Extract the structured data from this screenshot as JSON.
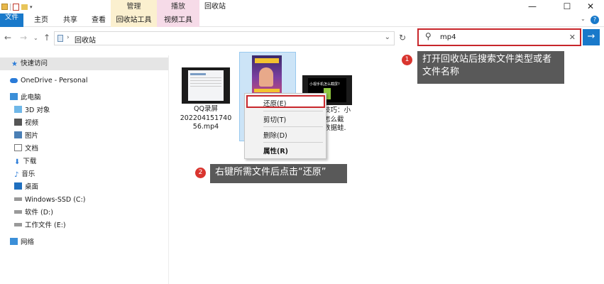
{
  "window": {
    "title": "回收站",
    "context_tabs": {
      "manage": "管理",
      "play": "播放"
    }
  },
  "ribbon": {
    "tabs": [
      "文件",
      "主页",
      "共享",
      "查看",
      "回收站工具",
      "视频工具"
    ]
  },
  "address": {
    "location": "回收站"
  },
  "search": {
    "query": "mp4"
  },
  "nav": {
    "items": [
      "快速访问",
      "OneDrive - Personal",
      "此电脑",
      "3D 对象",
      "视频",
      "图片",
      "文档",
      "下载",
      "音乐",
      "桌面",
      "Windows-SSD (C:)",
      "软件 (D:)",
      "工作文件 (E:)",
      "网络"
    ]
  },
  "files": [
    {
      "name_lines": [
        "QQ录屏",
        "202204151740",
        "56.mp4"
      ]
    },
    {
      "name_lines": [
        ""
      ]
    },
    {
      "name_lines": [
        "技巧：小",
        "怎么截",
        "数据蛙."
      ]
    }
  ],
  "thumb_text": {
    "third": "小视手机怎么截屏?"
  },
  "context_menu": {
    "items": [
      "还原(E)",
      "剪切(T)",
      "删除(D)",
      "属性(R)"
    ]
  },
  "callouts": {
    "step1_num": "1",
    "step1_text": "打开回收站后搜索文件类型或者文件名称",
    "step2_num": "2",
    "step2_text": "右键所需文件后点击“还原”"
  },
  "colors": {
    "accent": "#1979ca",
    "highlight_red": "#c8262b",
    "badge_red": "#d9352f",
    "callout_bg": "#595959"
  }
}
